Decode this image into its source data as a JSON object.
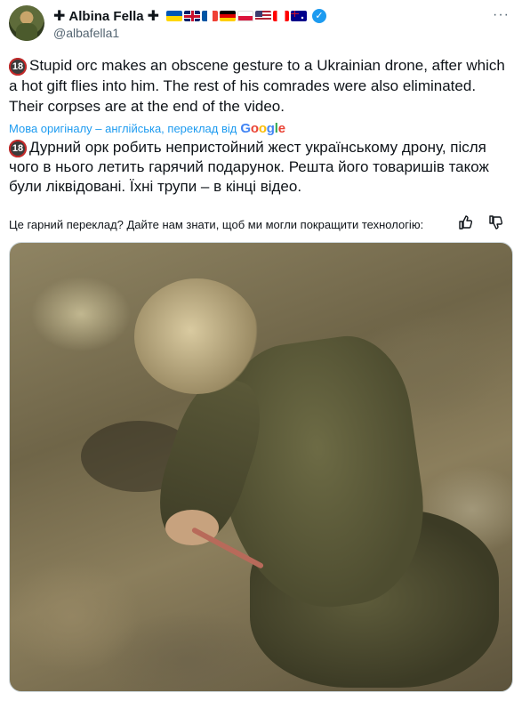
{
  "header": {
    "cross_left": "✚",
    "display_name": "Albina Fella",
    "cross_right": "✚",
    "handle": "@albafella1",
    "more_icon": "more-icon",
    "flags": [
      {
        "name": "ukraine-flag-icon",
        "colors": [
          "#0057b7",
          "#ffd700"
        ]
      },
      {
        "name": "uk-flag-icon",
        "colors": [
          "#012169",
          "#c8102e",
          "#ffffff"
        ]
      },
      {
        "name": "france-flag-icon",
        "colors": [
          "#0055a4",
          "#ffffff",
          "#ef4135"
        ]
      },
      {
        "name": "germany-flag-icon",
        "colors": [
          "#000000",
          "#dd0000",
          "#ffce00"
        ]
      },
      {
        "name": "poland-flag-icon",
        "colors": [
          "#ffffff",
          "#dc143c"
        ]
      },
      {
        "name": "usa-flag-icon",
        "colors": [
          "#b22234",
          "#ffffff",
          "#3c3b6e"
        ]
      },
      {
        "name": "canada-flag-icon",
        "colors": [
          "#ff0000",
          "#ffffff",
          "#ff0000"
        ]
      },
      {
        "name": "australia-flag-icon",
        "colors": [
          "#00008b",
          "#ffffff",
          "#ff0000"
        ]
      }
    ],
    "verified_icon": "verified-check-icon",
    "accent": "#1d9bf0"
  },
  "tweet": {
    "badge": "18",
    "text_en": "Stupid orc makes an obscene gesture to a Ukrainian drone, after which a hot gift flies into him. The rest of his comrades were also eliminated. Their corpses are at the end of the video.",
    "translated_by": "Мова оригіналу – англійська, переклад від",
    "google_logo": [
      "G",
      "o",
      "o",
      "g",
      "l",
      "e"
    ],
    "text_uk": "Дурний орк робить непристойний жест українському дрону, після чого в нього летить гарячий подарунок. Решта його товаришів також були ліквідовані. Їхні трупи – в кінці відео."
  },
  "feedback": {
    "text": "Це гарний переклад? Дайте нам знати, щоб ми могли покращити технологію:",
    "thumbs_up_icon": "thumbs-up-icon",
    "thumbs_down_icon": "thumbs-down-icon"
  },
  "media": {
    "type": "video-thumbnail"
  }
}
